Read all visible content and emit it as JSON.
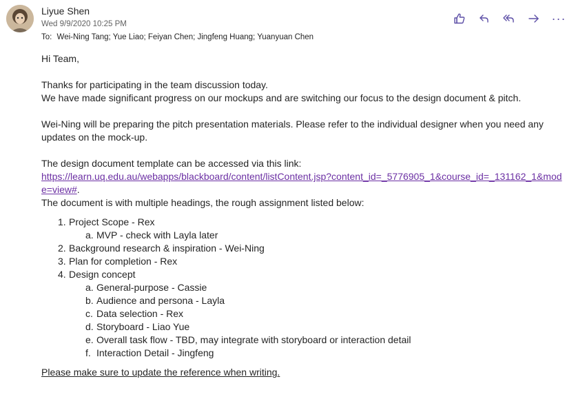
{
  "header": {
    "sender_name": "Liyue Shen",
    "date": "Wed 9/9/2020 10:25 PM",
    "to_label": "To:",
    "recipients": "Wei-Ning Tang; Yue Liao; Feiyan Chen; Jingfeng Huang; Yuanyuan Chen",
    "actions": {
      "like_icon": "thumbs-up-icon",
      "reply_icon": "reply-icon",
      "reply_all_icon": "reply-all-icon",
      "forward_icon": "forward-icon",
      "more_label": "···"
    },
    "accent_color": "#5c4ea6"
  },
  "body": {
    "greeting": "Hi Team,",
    "para1_line1": "Thanks for participating in the team discussion today.",
    "para1_line2": "We have made significant progress on our mockups and are switching our focus to the design document & pitch.",
    "para2": "Wei-Ning will be preparing the pitch presentation materials. Please refer to the individual designer when you need any updates on the mock-up.",
    "para3_intro": "The design document template can be accessed via this link:",
    "link_text": "https://learn.uq.edu.au/webapps/blackboard/content/listContent.jsp?content_id=_5776905_1&course_id=_131162_1&mode=view#",
    "link_trailing": ".",
    "para3_after": "The document is with multiple headings, the rough assignment listed below:",
    "list": [
      {
        "num": "1.",
        "text": "Project Scope - Rex",
        "sub": [
          {
            "num": "a.",
            "text": "MVP - check with Layla later"
          }
        ]
      },
      {
        "num": "2.",
        "text": "Background research & inspiration - Wei-Ning",
        "sub": []
      },
      {
        "num": "3.",
        "text": "Plan for completion - Rex",
        "sub": []
      },
      {
        "num": "4.",
        "text": "Design concept",
        "sub": [
          {
            "num": "a.",
            "text": "General-purpose - Cassie"
          },
          {
            "num": "b.",
            "text": "Audience and persona - Layla"
          },
          {
            "num": "c.",
            "text": "Data selection - Rex"
          },
          {
            "num": "d.",
            "text": "Storyboard - Liao Yue"
          },
          {
            "num": "e.",
            "text": "Overall task flow - TBD, may integrate with storyboard or interaction detail"
          },
          {
            "num": "f.",
            "text": "Interaction Detail - Jingfeng"
          }
        ]
      }
    ],
    "closing": "Please make sure to update the reference when writing."
  }
}
